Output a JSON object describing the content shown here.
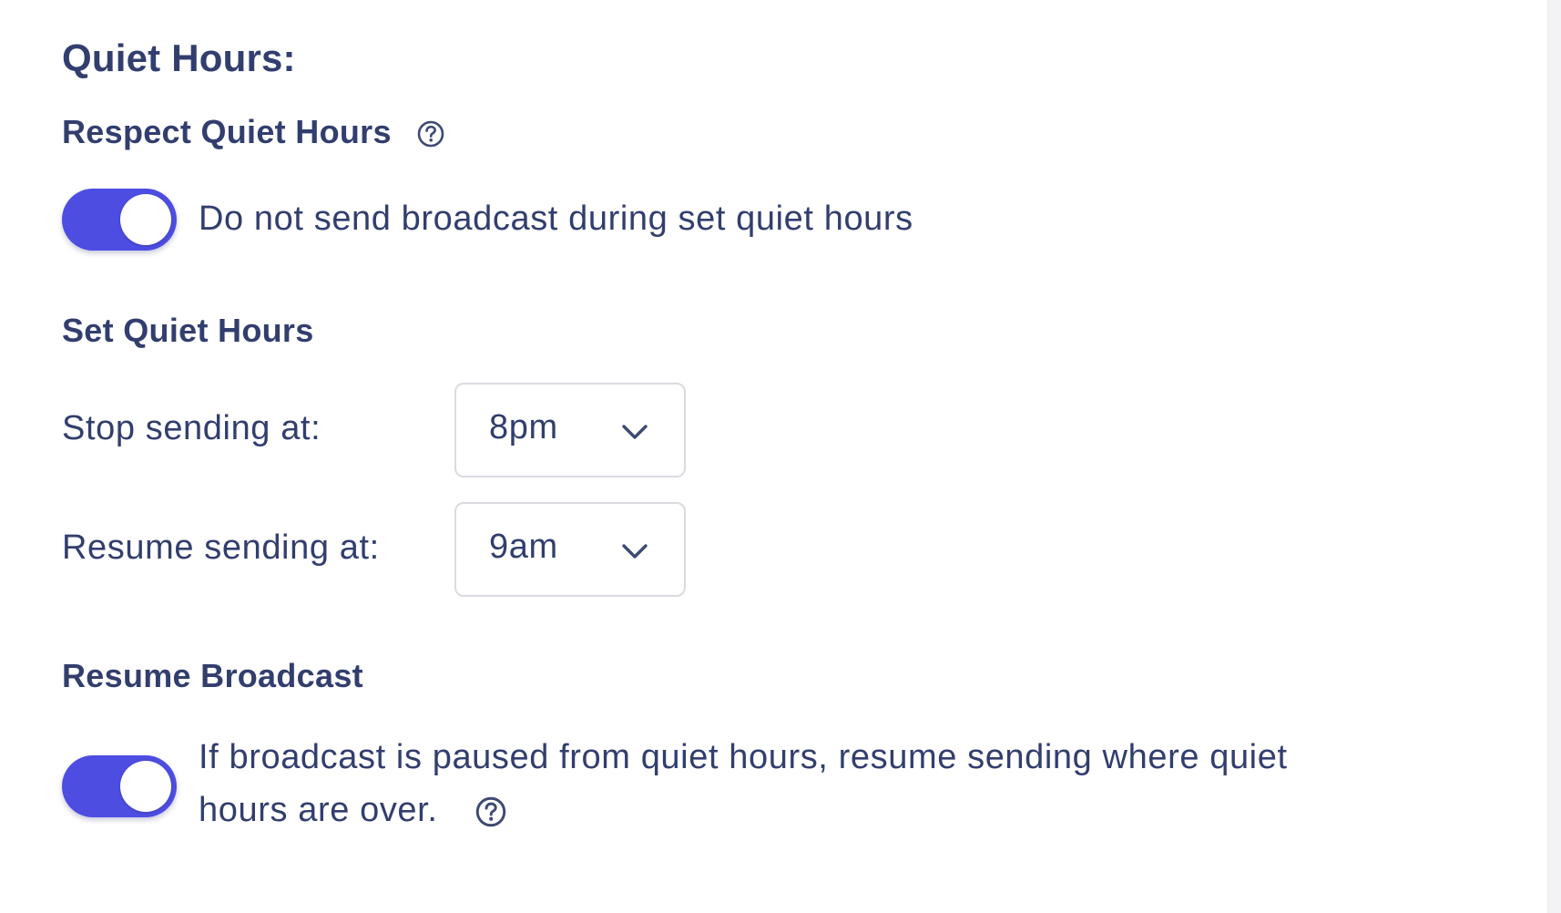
{
  "quiet_hours": {
    "title": "Quiet Hours:",
    "respect": {
      "heading": "Respect Quiet Hours",
      "help_icon": "help-circle-icon",
      "toggle_on": true,
      "toggle_label": "Do not send broadcast during set quiet hours"
    },
    "set_hours": {
      "heading": "Set Quiet Hours",
      "stop_label": "Stop sending at:",
      "stop_value": "8pm",
      "resume_label": "Resume sending at:",
      "resume_value": "9am",
      "dropdown_icon": "chevron-down-icon"
    },
    "resume_broadcast": {
      "heading": "Resume Broadcast",
      "toggle_on": true,
      "line1": "If broadcast is paused from quiet hours, resume sending where quiet",
      "line2": "hours are over.",
      "help_icon": "help-circle-icon"
    }
  },
  "colors": {
    "accent": "#4d4de2",
    "text": "#323e6e",
    "border": "#d9dbe1"
  }
}
